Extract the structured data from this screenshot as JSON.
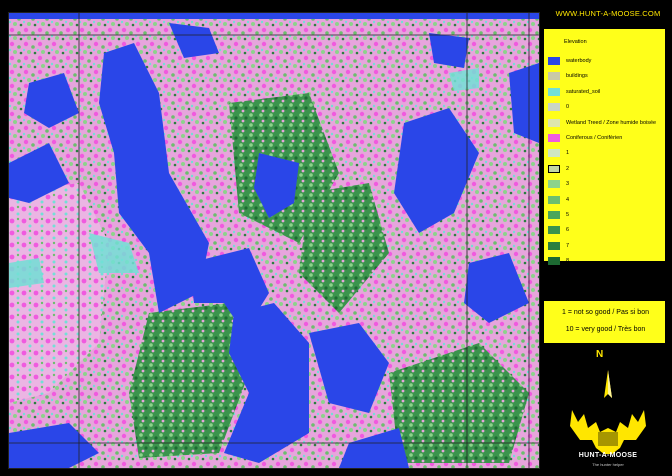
{
  "header": {
    "url": "WWW.HUNT-A-MOOSE.COM"
  },
  "legend": {
    "title": "Elevation",
    "items": [
      {
        "label": "waterbody",
        "color": "#2a46e8"
      },
      {
        "label": "buildings",
        "color": "#c9c9a6"
      },
      {
        "label": "saturated_soil",
        "color": "#72e0d6"
      },
      {
        "label": "0",
        "color": "#c9d5c4"
      },
      {
        "label": "Wetland Treed / Zone humide boisée",
        "color": "#dde6ae"
      },
      {
        "label": "Coniferous  / Conifèrien",
        "color": "#f05adf"
      },
      {
        "label": "1",
        "color": "#cfe7c2"
      },
      {
        "label": "2",
        "color": "#c3d7a4"
      },
      {
        "label": "3",
        "color": "#8cd38b"
      },
      {
        "label": "4",
        "color": "#6cbe6e"
      },
      {
        "label": "5",
        "color": "#4aa55a"
      },
      {
        "label": "6",
        "color": "#3b944d"
      },
      {
        "label": "7",
        "color": "#2a7f3f"
      },
      {
        "label": "8",
        "color": "#1d6a32"
      }
    ]
  },
  "notes": {
    "line1": "1 = not so good / Pas si bon",
    "line2": "10 = very good / Très bon"
  },
  "north_label": "N",
  "brand": {
    "name": "HUNT-A-MOOSE",
    "tagline": "The hunter helper"
  }
}
